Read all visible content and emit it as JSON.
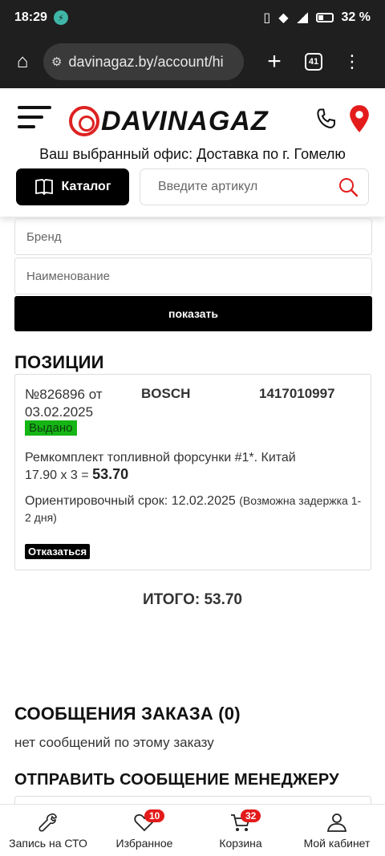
{
  "status_bar": {
    "time": "18:29",
    "battery": "32 %"
  },
  "browser": {
    "url": "davinagaz.by/account/hi",
    "tab_count": "41"
  },
  "header": {
    "logo_text": "DAVINAGAZ",
    "office_text": "Ваш выбранный офис: Доставка по г. Гомелю",
    "catalog_label": "Каталог",
    "search_placeholder": "Введите артикул"
  },
  "filters": {
    "brand_placeholder": "Бренд",
    "name_placeholder": "Наименование",
    "show_label": "показать"
  },
  "positions": {
    "title": "ПОЗИЦИИ",
    "items": [
      {
        "order": "№826896 от 03.02.2025",
        "brand": "BOSCH",
        "article": "1417010997",
        "status": "Выдано",
        "description": "Ремкомплект топливной форсунки #1*. Китай",
        "price_calc": "17.90 x 3 = ",
        "sum": "53.70",
        "eta_label": "Ориентировочный срок: 12.02.2025",
        "eta_note": "(Возможна задержка 1-2 дня)",
        "refuse_label": "Отказаться"
      }
    ],
    "total": "ИТОГО: 53.70"
  },
  "messages": {
    "title": "СООБЩЕНИЯ ЗАКАЗА (0)",
    "empty_text": "нет сообщений по этому заказу",
    "send_title": "ОТПРАВИТЬ СООБЩЕНИЕ МЕНЕДЖЕРУ"
  },
  "bottom_nav": {
    "items": [
      {
        "label": "Запись на СТО",
        "icon": "wrench-icon"
      },
      {
        "label": "Избранное",
        "icon": "heart-icon",
        "badge": "10"
      },
      {
        "label": "Корзина",
        "icon": "cart-icon",
        "badge": "32"
      },
      {
        "label": "Мой кабинет",
        "icon": "user-icon"
      }
    ]
  },
  "colors": {
    "accent_red": "#e31b1b",
    "status_green": "#16b516",
    "dark": "#000000"
  }
}
